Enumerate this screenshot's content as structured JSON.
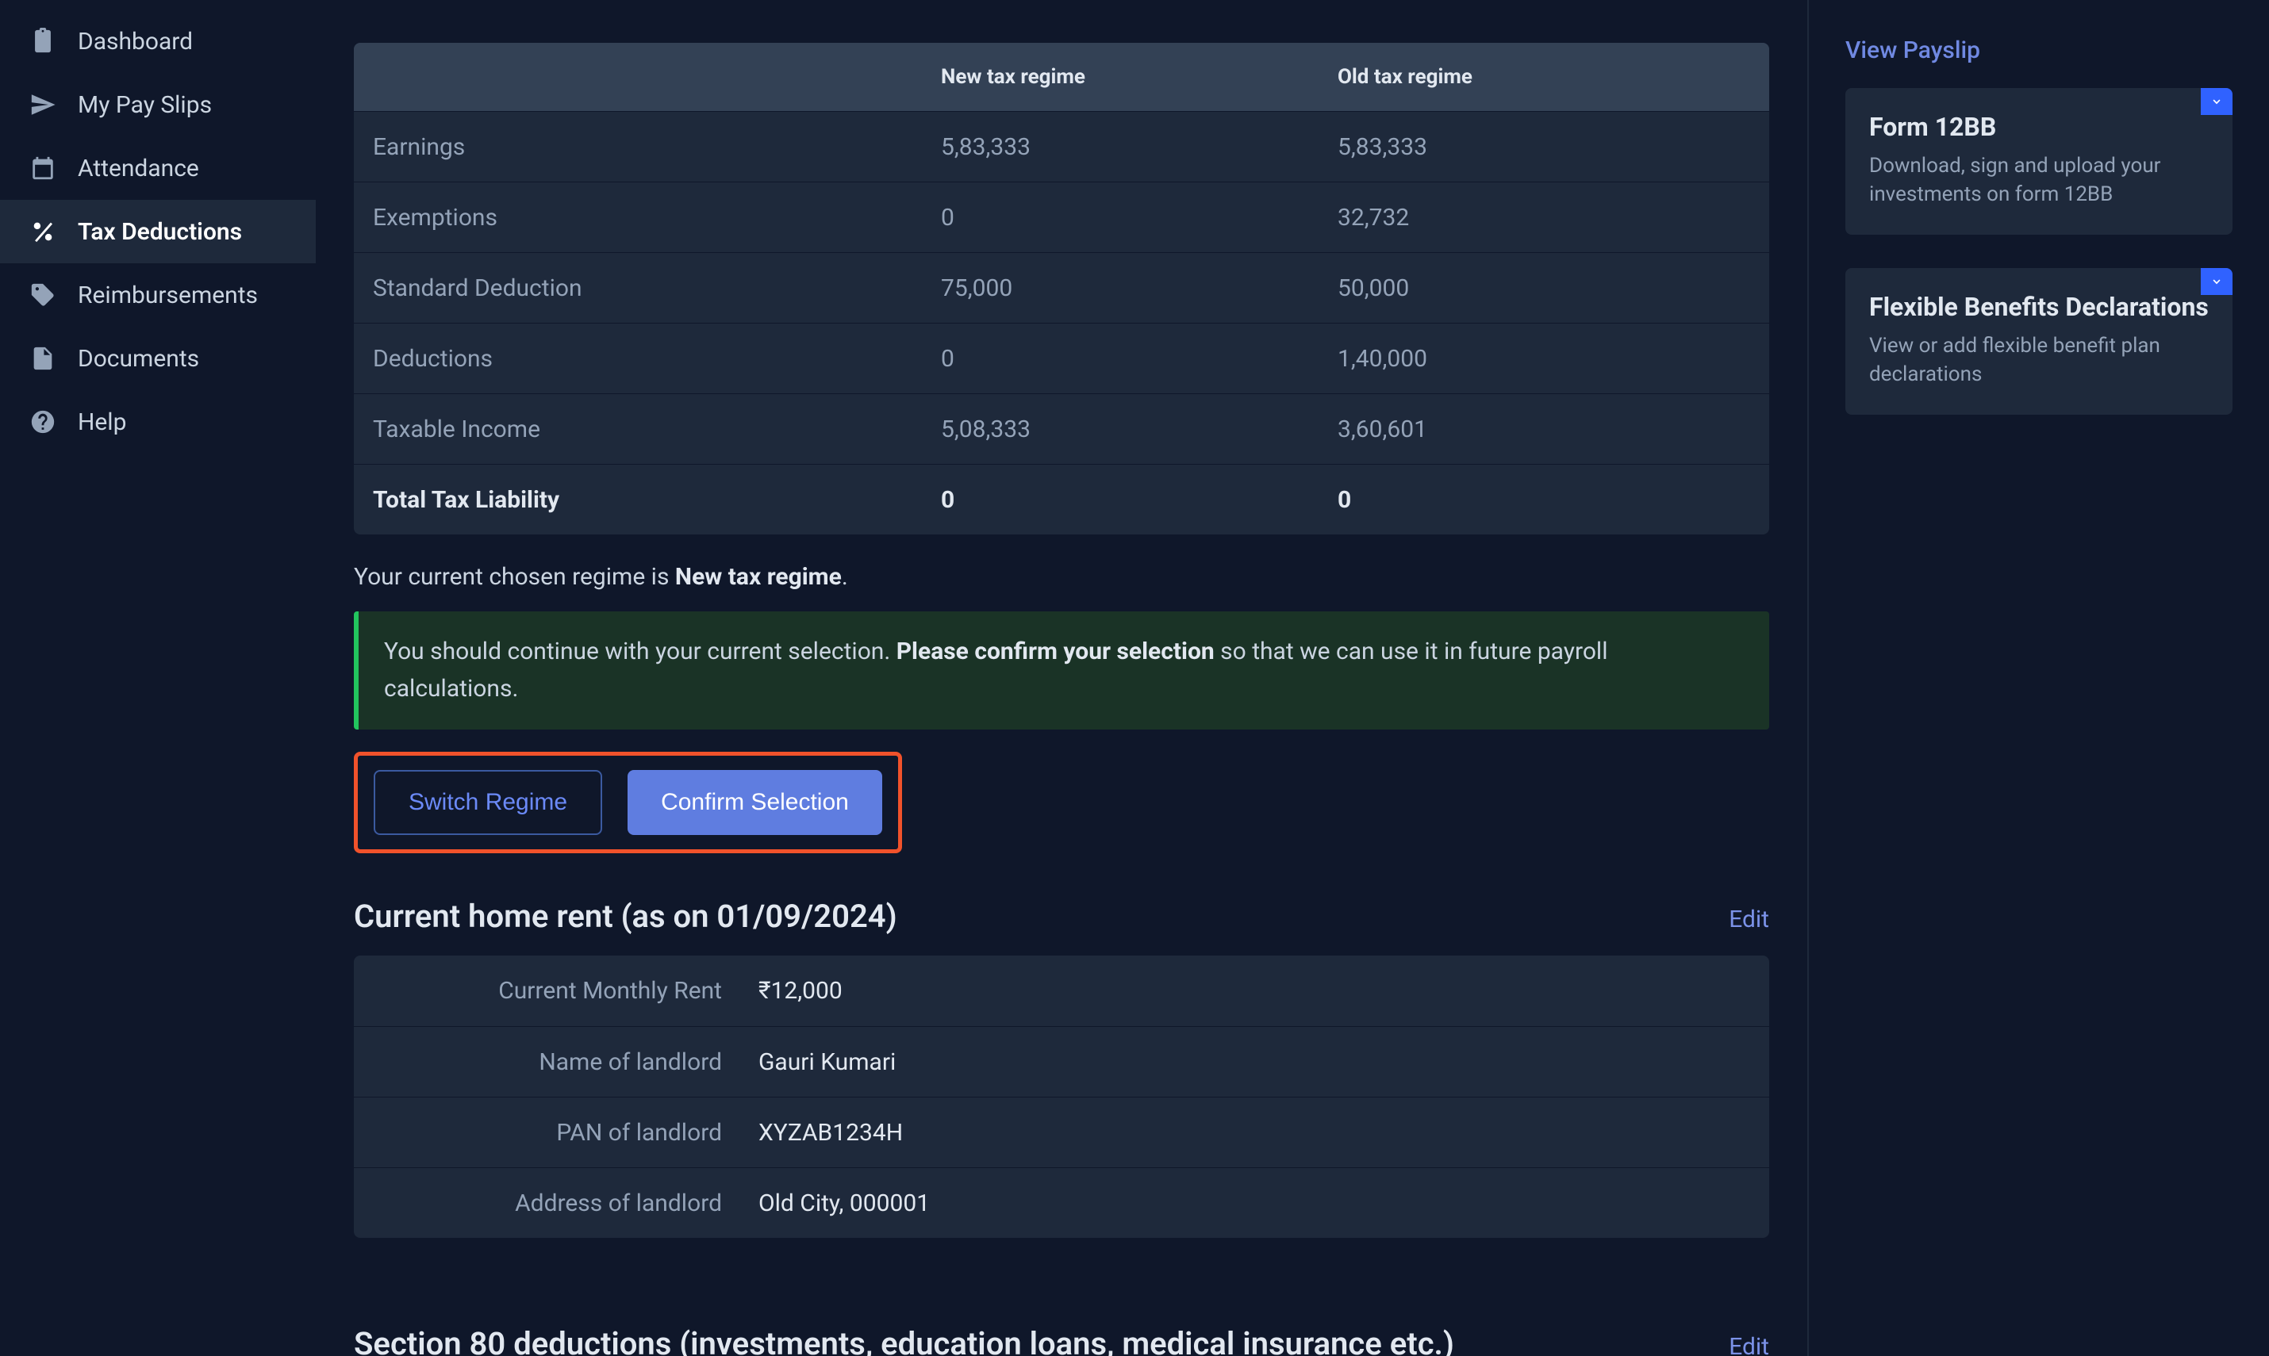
{
  "sidebar": {
    "items": [
      {
        "label": "Dashboard",
        "icon": "clipboard-icon"
      },
      {
        "label": "My Pay Slips",
        "icon": "paper-plane-icon"
      },
      {
        "label": "Attendance",
        "icon": "calendar-icon"
      },
      {
        "label": "Tax Deductions",
        "icon": "percent-icon"
      },
      {
        "label": "Reimbursements",
        "icon": "tag-icon"
      },
      {
        "label": "Documents",
        "icon": "document-icon"
      },
      {
        "label": "Help",
        "icon": "question-icon"
      }
    ],
    "active_index": 3
  },
  "tax_table": {
    "header_new": "New tax regime",
    "header_old": "Old tax regime",
    "rows": [
      {
        "label": "Earnings",
        "new": "5,83,333",
        "old": "5,83,333"
      },
      {
        "label": "Exemptions",
        "new": "0",
        "old": "32,732"
      },
      {
        "label": "Standard Deduction",
        "new": "75,000",
        "old": "50,000"
      },
      {
        "label": "Deductions",
        "new": "0",
        "old": "1,40,000"
      },
      {
        "label": "Taxable Income",
        "new": "5,08,333",
        "old": "3,60,601"
      },
      {
        "label": "Total Tax Liability",
        "new": "0",
        "old": "0",
        "bold": true
      }
    ]
  },
  "regime_note": {
    "prefix": "Your current chosen regime is ",
    "bold": "New tax regime",
    "suffix": "."
  },
  "alert": {
    "p1": "You should continue with your current selection. ",
    "bold": "Please confirm your selection",
    "p2": " so that we can use it in future payroll calculations."
  },
  "buttons": {
    "switch": "Switch Regime",
    "confirm": "Confirm Selection"
  },
  "home_rent": {
    "title": "Current home rent (as on 01/09/2024)",
    "edit": "Edit",
    "rows": [
      {
        "key": "Current Monthly Rent",
        "val": "₹12,000"
      },
      {
        "key": "Name of landlord",
        "val": "Gauri Kumari"
      },
      {
        "key": "PAN of landlord",
        "val": "XYZAB1234H"
      },
      {
        "key": "Address of landlord",
        "val": "Old City, 000001"
      }
    ]
  },
  "section80": {
    "title": "Section 80 deductions (investments, education loans, medical insurance etc.)",
    "edit": "Edit"
  },
  "right": {
    "view_payslip": "View Payslip",
    "cards": [
      {
        "title": "Form 12BB",
        "desc": "Download, sign and upload your investments on form 12BB"
      },
      {
        "title": "Flexible Benefits Declarations",
        "desc": "View or add flexible benefit plan declarations"
      }
    ]
  }
}
